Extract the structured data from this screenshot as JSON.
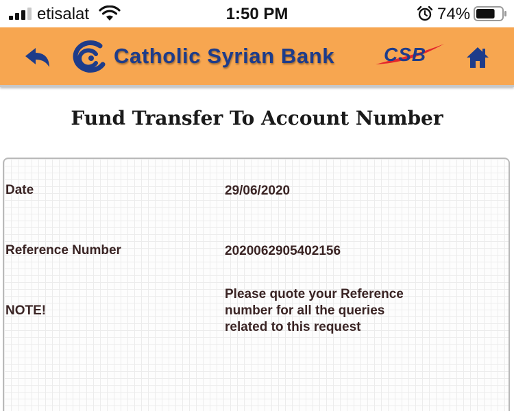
{
  "status_bar": {
    "carrier": "etisalat",
    "time": "1:50 PM",
    "battery_percent": "74%",
    "battery_level": 0.74,
    "icons": [
      "signal-icon",
      "wifi-icon",
      "alarm-icon",
      "battery-icon"
    ]
  },
  "header": {
    "bank_name": "Catholic Syrian Bank",
    "short_logo": "CSB",
    "icons": [
      "back-arrow-icon",
      "bank-logo-icon",
      "home-icon"
    ],
    "colors": {
      "background": "#f7a650",
      "brand_blue": "#1e3c8a",
      "accent_red": "#e3262d"
    }
  },
  "page": {
    "title": "Fund Transfer To Account Number"
  },
  "details": {
    "date_label": "Date",
    "date_value": "29/06/2020",
    "reference_label": "Reference Number",
    "reference_value": "2020062905402156",
    "note_label": "NOTE!",
    "note_line1": "Please quote your Reference",
    "note_line2": "number for all the queries",
    "note_line3": "related to this request"
  }
}
